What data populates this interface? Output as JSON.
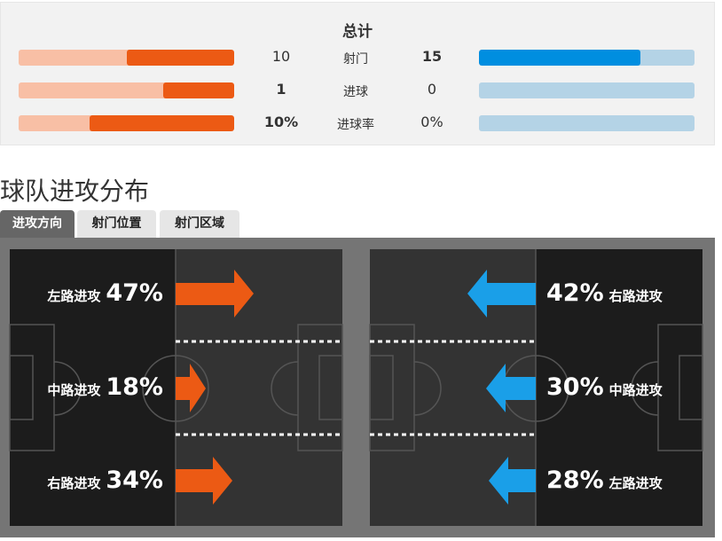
{
  "summary": {
    "title": "总计",
    "rows": [
      {
        "label": "射门",
        "home": "10",
        "away": "15",
        "home_bold": false,
        "away_bold": true,
        "home_fill": 0.5,
        "away_fill": 0.75
      },
      {
        "label": "进球",
        "home": "1",
        "away": "0",
        "home_bold": true,
        "away_bold": false,
        "home_fill": 0.33,
        "away_fill": 0
      },
      {
        "label": "进球率",
        "home": "10%",
        "away": "0%",
        "home_bold": true,
        "away_bold": false,
        "home_fill": 0.67,
        "away_fill": 0
      }
    ]
  },
  "section_title": "球队进攻分布",
  "tabs": [
    {
      "label": "进攻方向",
      "active": true
    },
    {
      "label": "射门位置",
      "active": false
    },
    {
      "label": "射门区域",
      "active": false
    }
  ],
  "home_attack": [
    {
      "label": "左路进攻",
      "pct": "47%"
    },
    {
      "label": "中路进攻",
      "pct": "18%"
    },
    {
      "label": "右路进攻",
      "pct": "34%"
    }
  ],
  "away_attack": [
    {
      "label": "右路进攻",
      "pct": "42%"
    },
    {
      "label": "中路进攻",
      "pct": "30%"
    },
    {
      "label": "左路进攻",
      "pct": "28%"
    }
  ],
  "colors": {
    "home": "#ec5a14",
    "away": "#1a9fe8",
    "home_light": "#f8bfa5",
    "away_light": "#b4d3e6"
  }
}
